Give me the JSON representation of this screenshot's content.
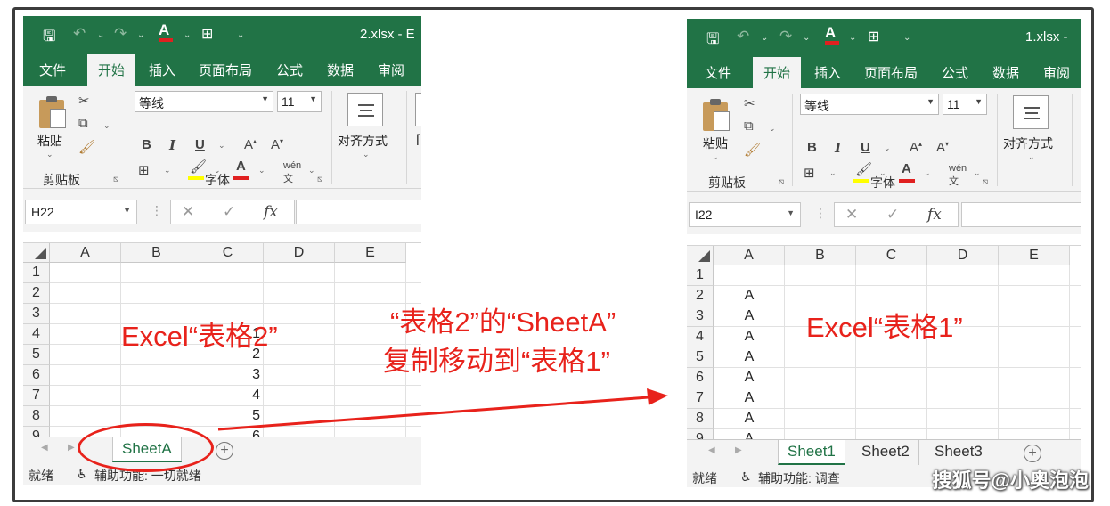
{
  "colors": {
    "excel_green": "#217346",
    "annotation_red": "#e8221b",
    "ribbon_bg": "#f3f3f3"
  },
  "left_window": {
    "file_name": "2.xlsx - E",
    "name_box": "H22",
    "tabs": [
      "文件",
      "开始",
      "插入",
      "页面布局",
      "公式",
      "数据",
      "审阅"
    ],
    "active_tab": "开始",
    "ribbon": {
      "paste_label": "粘贴",
      "clipboard_group": "剪贴板",
      "font_name": "等线",
      "font_size": "11",
      "font_group": "字体",
      "align_label": "对齐方式"
    },
    "columns": [
      "A",
      "B",
      "C",
      "D",
      "E"
    ],
    "rows": [
      "1",
      "2",
      "3",
      "4",
      "5",
      "6",
      "7",
      "8",
      "9"
    ],
    "column_c_values": [
      "1",
      "2",
      "3",
      "4",
      "5",
      "6"
    ],
    "sheet_tabs": [
      "SheetA"
    ],
    "status_ready": "就绪",
    "accessibility": "辅助功能: 一切就绪"
  },
  "right_window": {
    "file_name": "1.xlsx -",
    "name_box": "I22",
    "tabs": [
      "文件",
      "开始",
      "插入",
      "页面布局",
      "公式",
      "数据",
      "审阅"
    ],
    "active_tab": "开始",
    "ribbon": {
      "paste_label": "粘贴",
      "clipboard_group": "剪贴板",
      "font_name": "等线",
      "font_size": "11",
      "font_group": "字体",
      "align_label": "对齐方式"
    },
    "columns": [
      "A",
      "B",
      "C",
      "D",
      "E"
    ],
    "rows": [
      "1",
      "2",
      "3",
      "4",
      "5",
      "6",
      "7",
      "8",
      "9"
    ],
    "column_a_values": [
      "A",
      "A",
      "A",
      "A",
      "A",
      "A",
      "A",
      "A"
    ],
    "sheet_tabs": [
      "Sheet1",
      "Sheet2",
      "Sheet3"
    ],
    "status_ready": "就绪",
    "accessibility": "辅助功能: 调查"
  },
  "annotations": {
    "left_label": "Excel“表格2”",
    "middle_line1": "“表格2”的“SheetA”",
    "middle_line2": "复制移动到“表格1”",
    "right_label": "Excel“表格1”"
  },
  "watermark": "搜狐号@小奥泡泡"
}
